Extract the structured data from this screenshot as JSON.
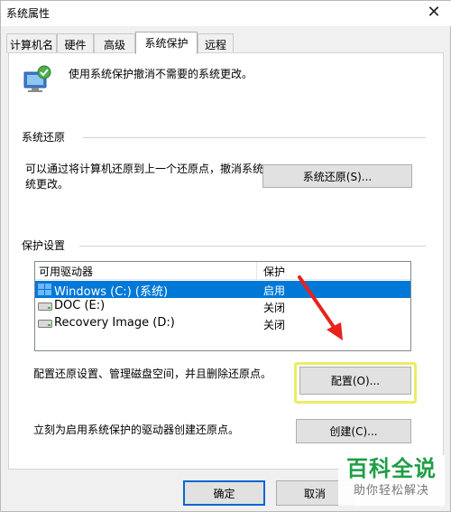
{
  "window": {
    "title": "系统属性",
    "close_symbol": "✕"
  },
  "tabs": [
    {
      "label": "计算机名",
      "active": false
    },
    {
      "label": "硬件",
      "active": false
    },
    {
      "label": "高级",
      "active": false
    },
    {
      "label": "系统保护",
      "active": true
    },
    {
      "label": "远程",
      "active": false
    }
  ],
  "intro": {
    "icon": "system-protection-icon",
    "text": "使用系统保护撤消不需要的系统更改。"
  },
  "restore_group": {
    "title": "系统还原",
    "description_line1": "可以通过将计算机还原到上一个还原点，撤消系统",
    "description_line2": "统更改。",
    "button": "系统还原(S)..."
  },
  "protection_group": {
    "title": "保护设置",
    "columns": [
      "可用驱动器",
      "保护"
    ],
    "drives": [
      {
        "name": "Windows (C:) (系统)",
        "protection": "启用",
        "selected": true,
        "icon": "system-drive-icon"
      },
      {
        "name": "DOC (E:)",
        "protection": "关闭",
        "selected": false,
        "icon": "drive-icon"
      },
      {
        "name": "Recovery Image (D:)",
        "protection": "关闭",
        "selected": false,
        "icon": "drive-icon"
      }
    ],
    "configure_text": "配置还原设置、管理磁盘空间，并且删除还原点。",
    "configure_button": "配置(O)...",
    "create_text": "立刻为启用系统保护的驱动器创建还原点。",
    "create_button": "创建(C)..."
  },
  "footer": {
    "ok": "确定",
    "cancel": "取消"
  },
  "watermark": {
    "line1": "百科全说",
    "line2": "助你轻松解决"
  },
  "colors": {
    "selection": "#0078d7",
    "highlight_box": "#ecec67",
    "arrow": "#e8221c",
    "watermark_green": "#1f9e45"
  }
}
